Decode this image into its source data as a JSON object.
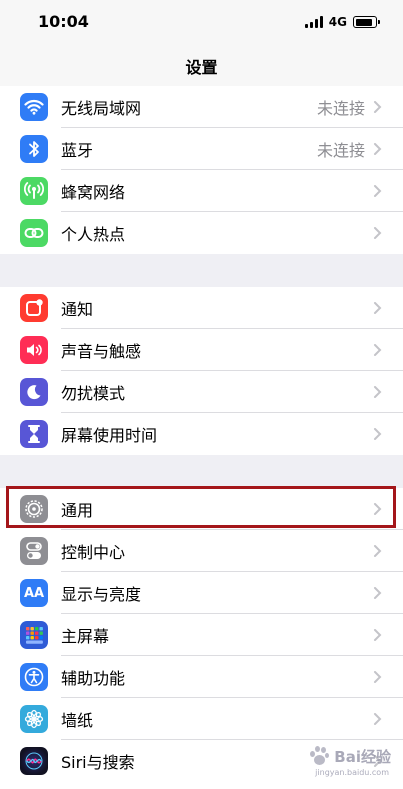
{
  "status_bar": {
    "time": "10:04",
    "network": "4G",
    "battery_level": 0.85
  },
  "nav": {
    "title": "设置"
  },
  "groups": [
    {
      "items": [
        {
          "label": "无线局域网",
          "detail": "未连接",
          "icon": "wifi-icon",
          "color": "#2f7cf6"
        },
        {
          "label": "蓝牙",
          "detail": "未连接",
          "icon": "bluetooth-icon",
          "color": "#2f7cf6"
        },
        {
          "label": "蜂窝网络",
          "detail": "",
          "icon": "cellular-icon",
          "color": "#4cd964"
        },
        {
          "label": "个人热点",
          "detail": "",
          "icon": "hotspot-icon",
          "color": "#4cd964"
        }
      ]
    },
    {
      "items": [
        {
          "label": "通知",
          "detail": "",
          "icon": "notifications-icon",
          "color": "#ff3b30"
        },
        {
          "label": "声音与触感",
          "detail": "",
          "icon": "sounds-icon",
          "color": "#ff2d55"
        },
        {
          "label": "勿扰模式",
          "detail": "",
          "icon": "moon-icon",
          "color": "#5856d6"
        },
        {
          "label": "屏幕使用时间",
          "detail": "",
          "icon": "hourglass-icon",
          "color": "#5856d6"
        }
      ]
    },
    {
      "items": [
        {
          "label": "通用",
          "detail": "",
          "icon": "gear-icon",
          "color": "#8e8e93"
        },
        {
          "label": "控制中心",
          "detail": "",
          "icon": "control-center-icon",
          "color": "#8e8e93"
        },
        {
          "label": "显示与亮度",
          "detail": "",
          "icon": "display-icon",
          "icon_text": "AA",
          "color": "#2f7cf6"
        },
        {
          "label": "主屏幕",
          "detail": "",
          "icon": "home-screen-icon",
          "color": "#2f5bd6"
        },
        {
          "label": "辅助功能",
          "detail": "",
          "icon": "accessibility-icon",
          "color": "#2f7cf6"
        },
        {
          "label": "墙纸",
          "detail": "",
          "icon": "wallpaper-icon",
          "color": "#34aadc"
        },
        {
          "label": "Siri与搜索",
          "detail": "",
          "icon": "siri-icon",
          "color": "#1c1c2e"
        }
      ]
    }
  ],
  "highlighted_item": "通用",
  "watermark": {
    "text": "Bai经验",
    "url": "jingyan.baidu.com"
  }
}
